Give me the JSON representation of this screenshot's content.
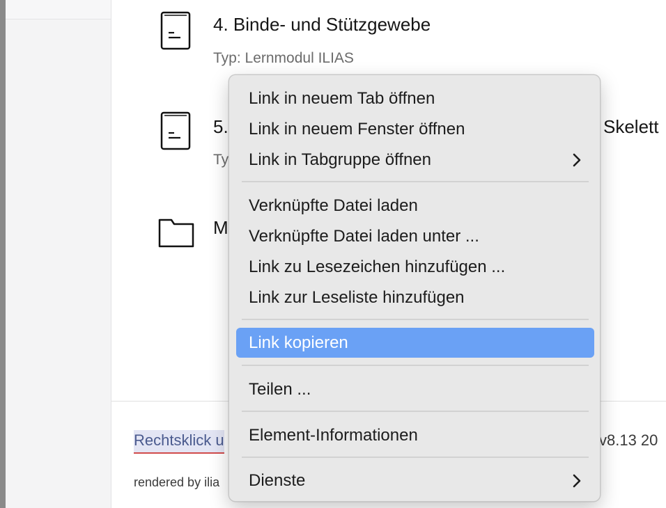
{
  "items": [
    {
      "title": "4. Binde- und Stützgewebe",
      "subtitle": "Typ: Lernmodul ILIAS",
      "icon": "learning-module-icon"
    },
    {
      "title": "5.",
      "title_right": "Skelett",
      "subtitle": "Ty",
      "icon": "learning-module-icon"
    },
    {
      "title": "M",
      "icon": "folder-icon"
    }
  ],
  "footer": {
    "link_text": "Rechtsklick u",
    "version": "v8.13 20",
    "rendered": "rendered by ilia"
  },
  "context_menu": {
    "items": [
      {
        "label": "Link in neuem Tab öffnen"
      },
      {
        "label": "Link in neuem Fenster öffnen"
      },
      {
        "label": "Link in Tabgruppe öffnen",
        "submenu": true
      },
      {
        "label": "Verknüpfte Datei laden"
      },
      {
        "label": "Verknüpfte Datei laden unter ..."
      },
      {
        "label": "Link zu Lesezeichen hinzufügen ..."
      },
      {
        "label": "Link zur Leseliste hinzufügen"
      },
      {
        "label": "Link kopieren",
        "highlighted": true
      },
      {
        "label": "Teilen ..."
      },
      {
        "label": "Element-Informationen"
      },
      {
        "label": "Dienste",
        "submenu": true
      }
    ],
    "highlight_color": "#6aa1f5"
  }
}
